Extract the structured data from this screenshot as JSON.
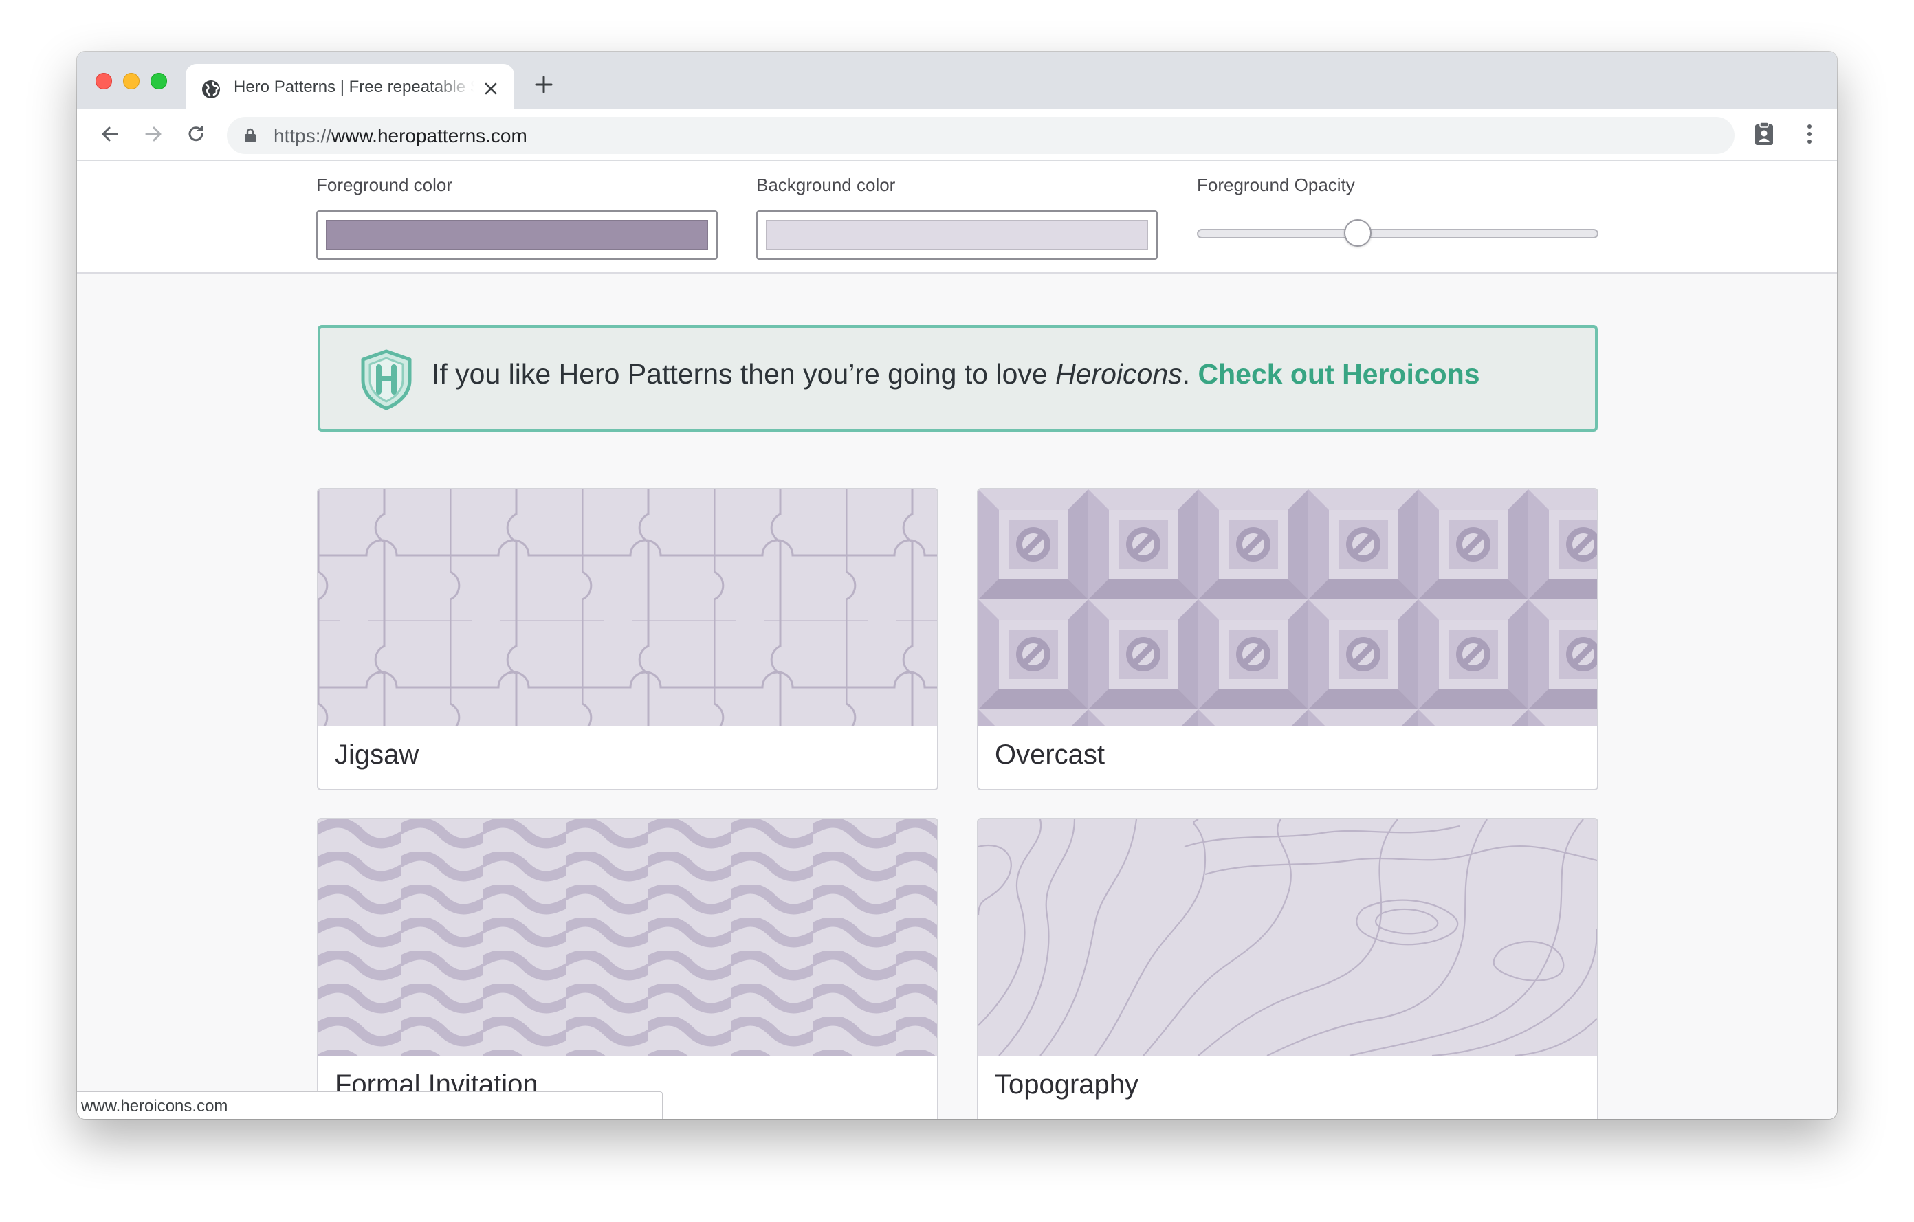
{
  "browser": {
    "tab_title": "Hero Patterns | Free repeatable SVG background patterns",
    "url_scheme": "https://",
    "url_host": "www.heropatterns.com",
    "status_url": "www.heroicons.com"
  },
  "controls": {
    "foreground_label": "Foreground color",
    "foreground_value": "#9d90a9",
    "background_label": "Background color",
    "background_value": "#dfdbe5",
    "opacity_label": "Foreground Opacity",
    "opacity_value": 0.4
  },
  "banner": {
    "text_before": "If you like Hero Patterns then you’re going to love ",
    "product": "Heroicons",
    "period": ".",
    "link_text": "Check out Heroicons",
    "accent": "#38a583"
  },
  "patterns": [
    {
      "name": "Jigsaw"
    },
    {
      "name": "Overcast"
    },
    {
      "name": "Formal Invitation"
    },
    {
      "name": "Topography"
    }
  ],
  "icons": {
    "tab_favicon": "globe-icon",
    "close": "close-icon",
    "new_tab": "plus-icon",
    "back": "arrow-left-icon",
    "forward": "arrow-right-icon",
    "reload": "reload-icon",
    "lock": "lock-icon",
    "extension": "clipboard-user-icon",
    "menu": "kebab-menu-icon",
    "banner": "heroicons-shield-logo"
  }
}
